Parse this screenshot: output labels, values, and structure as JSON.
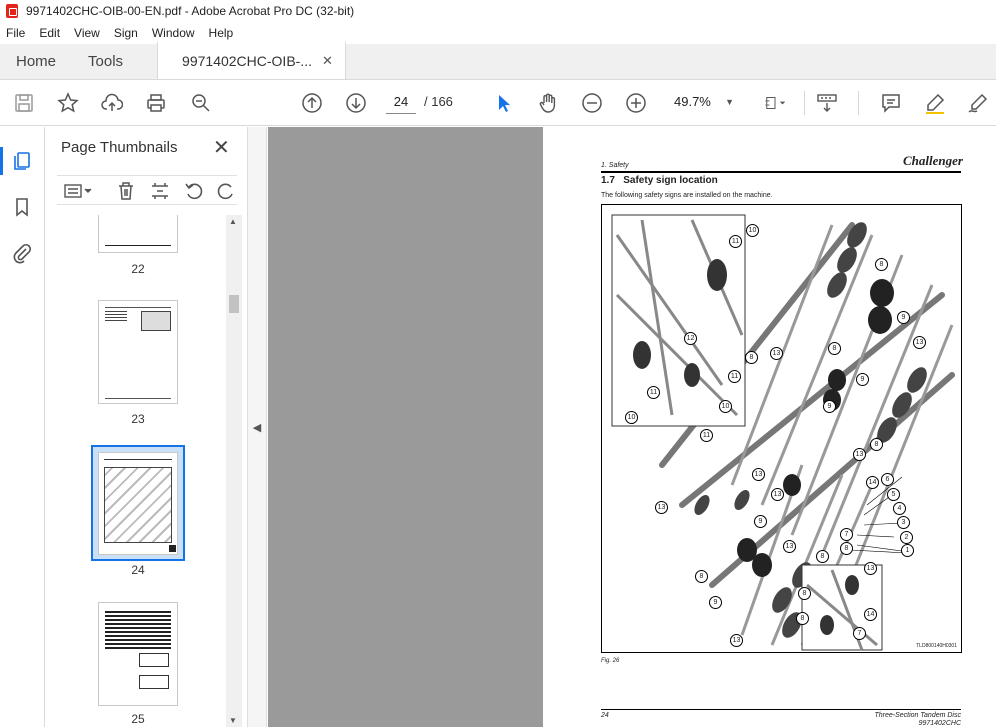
{
  "window": {
    "title": "9971402CHC-OIB-00-EN.pdf - Adobe Acrobat Pro DC (32-bit)"
  },
  "menu": [
    "File",
    "Edit",
    "View",
    "Sign",
    "Window",
    "Help"
  ],
  "tabs": {
    "home": "Home",
    "tools": "Tools",
    "document": "9971402CHC-OIB-..."
  },
  "toolbar": {
    "page_current": "24",
    "page_total": "/ 166",
    "zoom": "49.7%"
  },
  "panel": {
    "title": "Page Thumbnails",
    "thumbnails": [
      {
        "label": "22"
      },
      {
        "label": "23"
      },
      {
        "label": "24",
        "selected": true
      },
      {
        "label": "25"
      }
    ]
  },
  "page": {
    "header_section": "1. Safety",
    "logo": "Challenger",
    "heading_number": "1.7",
    "heading": "Safety sign location",
    "intro": "The following safety signs are installed on the machine.",
    "figure_code": "TLD800140H0301",
    "figure_label": "Fig. 26",
    "footer_number": "24",
    "footer_title": "Three-Section Tandem Disc",
    "footer_code": "9971402CHC",
    "callouts": [
      "10",
      "11",
      "8",
      "9",
      "12",
      "8",
      "13",
      "8",
      "9",
      "11",
      "11",
      "10",
      "10",
      "11",
      "9",
      "13",
      "8",
      "13",
      "13",
      "13",
      "14",
      "6",
      "5",
      "4",
      "3",
      "2",
      "1",
      "13",
      "7",
      "8",
      "9",
      "13",
      "8",
      "13",
      "8",
      "8",
      "9",
      "14",
      "7",
      "13",
      "8"
    ]
  },
  "colors": {
    "accent": "#1473e6",
    "doc_bg": "#9a9a9a"
  }
}
